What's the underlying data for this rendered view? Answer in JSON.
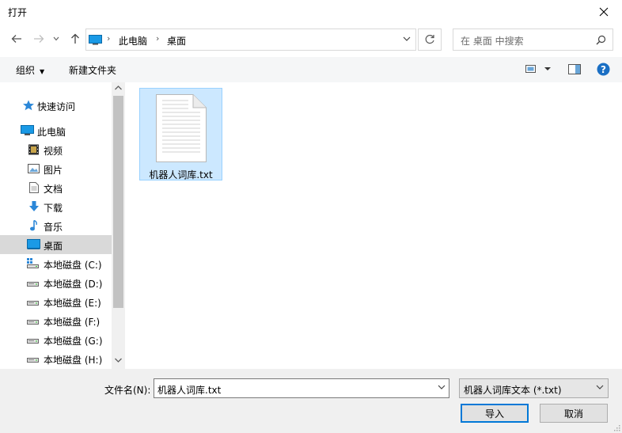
{
  "window": {
    "title": "打开"
  },
  "address": {
    "crumbs": [
      "此电脑",
      "桌面"
    ]
  },
  "search": {
    "placeholder": "在 桌面 中搜索"
  },
  "toolbar": {
    "organize_label": "组织",
    "new_folder_label": "新建文件夹"
  },
  "sidebar": {
    "items": [
      {
        "label": "快速访问",
        "icon": "star-icon"
      },
      {
        "label": "此电脑",
        "icon": "computer-icon"
      },
      {
        "label": "视频",
        "icon": "video-icon"
      },
      {
        "label": "图片",
        "icon": "pictures-icon"
      },
      {
        "label": "文档",
        "icon": "documents-icon"
      },
      {
        "label": "下载",
        "icon": "download-icon"
      },
      {
        "label": "音乐",
        "icon": "music-icon"
      },
      {
        "label": "桌面",
        "icon": "desktop-icon",
        "selected": true
      },
      {
        "label": "本地磁盘 (C:)",
        "icon": "windows-drive-icon"
      },
      {
        "label": "本地磁盘 (D:)",
        "icon": "drive-icon"
      },
      {
        "label": "本地磁盘 (E:)",
        "icon": "drive-icon"
      },
      {
        "label": "本地磁盘 (F:)",
        "icon": "drive-icon"
      },
      {
        "label": "本地磁盘 (G:)",
        "icon": "drive-icon"
      },
      {
        "label": "本地磁盘 (H:)",
        "icon": "drive-icon"
      }
    ]
  },
  "files": [
    {
      "name": "机器人词库.txt",
      "icon": "text-file-icon",
      "selected": true
    }
  ],
  "footer": {
    "filename_label": "文件名(N):",
    "filename_value": "机器人词库.txt",
    "filter_value": "机器人词库文本 (*.txt)",
    "open_label": "导入",
    "cancel_label": "取消"
  },
  "colors": {
    "accent": "#0078d7",
    "selection": "#cce8ff",
    "selection_border": "#99d1ff",
    "help": "#1a6fc4"
  }
}
